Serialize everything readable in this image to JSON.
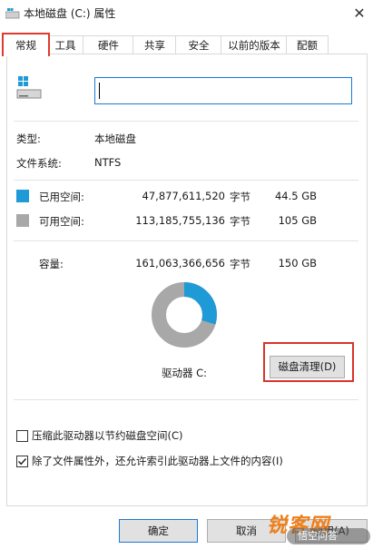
{
  "window": {
    "title": "本地磁盘 (C:) 属性",
    "close_symbol": "✕"
  },
  "tabs": [
    {
      "label": "常规",
      "active": true
    },
    {
      "label": "工具"
    },
    {
      "label": "硬件"
    },
    {
      "label": "共享"
    },
    {
      "label": "安全"
    },
    {
      "label": "以前的版本"
    },
    {
      "label": "配额"
    }
  ],
  "name_input": {
    "value": ""
  },
  "info": {
    "type_label": "类型:",
    "type_value": "本地磁盘",
    "fs_label": "文件系统:",
    "fs_value": "NTFS"
  },
  "usage": {
    "used": {
      "label": "已用空间:",
      "bytes": "47,877,611,520",
      "unit": "字节",
      "gb": "44.5 GB",
      "color": "#1e9ad6"
    },
    "free": {
      "label": "可用空间:",
      "bytes": "113,185,755,136",
      "unit": "字节",
      "gb": "105 GB",
      "color": "#a8a8a8"
    },
    "capacity": {
      "label": "容量:",
      "bytes": "161,063,366,656",
      "unit": "字节",
      "gb": "150 GB"
    },
    "used_fraction": 0.297
  },
  "drive_label": "驱动器 C:",
  "cleanup_button": "磁盘清理(D)",
  "options": {
    "compress": {
      "label": "压缩此驱动器以节约磁盘空间(C)",
      "checked": false
    },
    "index": {
      "label": "除了文件属性外，还允许索引此驱动器上文件的内容(I)",
      "checked": true
    }
  },
  "buttons": {
    "ok": "确定",
    "cancel": "取消",
    "apply": "应用(A)"
  },
  "watermark": {
    "brand": "锐客网",
    "badge": "悟空问答"
  }
}
